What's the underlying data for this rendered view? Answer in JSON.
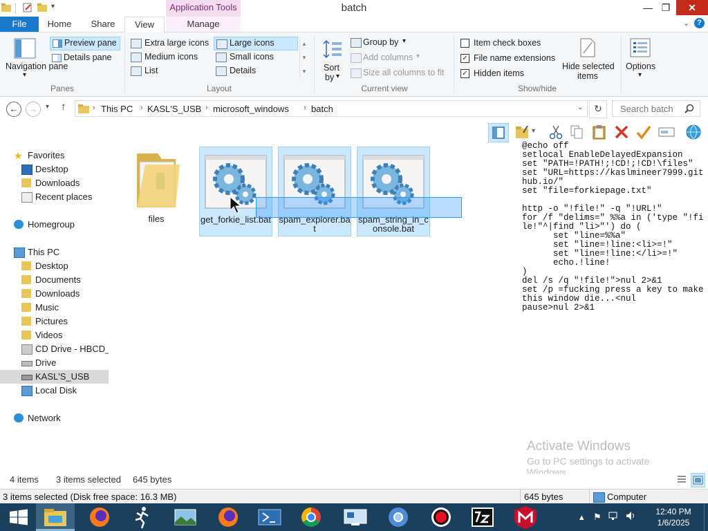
{
  "window": {
    "title": "batch",
    "contextual_tab_group": "Application Tools",
    "minimize_glyph": "—",
    "maximize_glyph": "❐",
    "close_glyph": "✕",
    "help_glyph": "?"
  },
  "ribbon_tabs": [
    "File",
    "Home",
    "Share",
    "View",
    "Manage"
  ],
  "ribbon": {
    "panes": {
      "navigation_pane": "Navigation pane",
      "preview_pane": "Preview pane",
      "details_pane": "Details pane",
      "label": "Panes"
    },
    "layout": {
      "extra_large_icons": "Extra large icons",
      "large_icons": "Large icons",
      "medium_icons": "Medium icons",
      "small_icons": "Small icons",
      "list": "List",
      "details": "Details",
      "label": "Layout"
    },
    "current_view": {
      "sort_by_1": "Sort",
      "sort_by_2": "by",
      "group_by": "Group by",
      "add_columns": "Add columns",
      "size_all_columns": "Size all columns to fit",
      "label": "Current view"
    },
    "show_hide": {
      "item_check_boxes": "Item check boxes",
      "item_check_boxes_checked": false,
      "file_name_extensions": "File name extensions",
      "file_name_extensions_checked": true,
      "hidden_items": "Hidden items",
      "hidden_items_checked": true,
      "hide_selected_items_1": "Hide selected",
      "hide_selected_items_2": "items",
      "label": "Show/hide"
    },
    "options": "Options"
  },
  "address": {
    "breadcrumbs": [
      "This PC",
      "KASL'S_USB",
      "microsoft_windows",
      "batch"
    ],
    "search_placeholder": "Search batch"
  },
  "nav": {
    "favorites_header": "Favorites",
    "favorites": [
      "Desktop",
      "Downloads",
      "Recent places"
    ],
    "homegroup": "Homegroup",
    "this_pc_header": "This PC",
    "this_pc": [
      "Desktop",
      "Documents",
      "Downloads",
      "Music",
      "Pictures",
      "Videos",
      "CD Drive - HBCD_",
      "Drive",
      "KASL'S_USB",
      "Local Disk"
    ],
    "network": "Network"
  },
  "files": [
    {
      "name": "files",
      "type": "folder",
      "selected": false
    },
    {
      "name": "get_forkie_list.bat",
      "type": "bat",
      "selected": true
    },
    {
      "name": "spam_explorer.bat",
      "type": "bat",
      "selected": true
    },
    {
      "name": "spam_string_in_console.bat",
      "type": "bat",
      "selected": true
    }
  ],
  "preview_text": "@echo off\nsetlocal EnableDelayedExpansion\nset \"PATH=!PATH!;!CD!;!CD!\\files\"\nset \"URL=https://kaslmineer7999.github.io/\"\nset \"file=forkiepage.txt\"\n\nhttp -o \"!file!\" -q \"!URL!\"\nfor /f \"delims=\" %%a in ('type \"!file!\"^|find \"li>\"') do (\n      set \"line=%%a\"\n      set \"line=!line:<li>=!\"\n      set \"line=!line:</li>=!\"\n      echo.!line!\n)\ndel /s /q \"!file!\">nul 2>&1\nset /p =fucking press a key to make this window die...<nul\npause>nul 2>&1",
  "watermark": {
    "title": "Activate Windows",
    "subtitle": "Go to PC settings to activate Windows."
  },
  "status": {
    "item_count": "4 items",
    "selection": "3 items selected",
    "size": "645 bytes"
  },
  "details_bar": {
    "selection_info": "3 items selected (Disk free space: 16.3 MB)",
    "size": "645 bytes",
    "location": "Computer"
  },
  "taskbar": {
    "apps": [
      "start",
      "file-explorer",
      "firefox",
      "runner",
      "photo-app",
      "firefox-2",
      "powershell",
      "chrome",
      "remote-desktop",
      "chromium",
      "recorder",
      "7zip",
      "mcafee"
    ],
    "time": "12:40 PM",
    "date": "1/6/2025"
  },
  "colors": {
    "accent": "#1979ca",
    "selection_fill": "#cce8ff",
    "selection_border": "#99d1ff",
    "taskbar": "#1c3f5c",
    "contextual_tab": "#f3dcef"
  }
}
